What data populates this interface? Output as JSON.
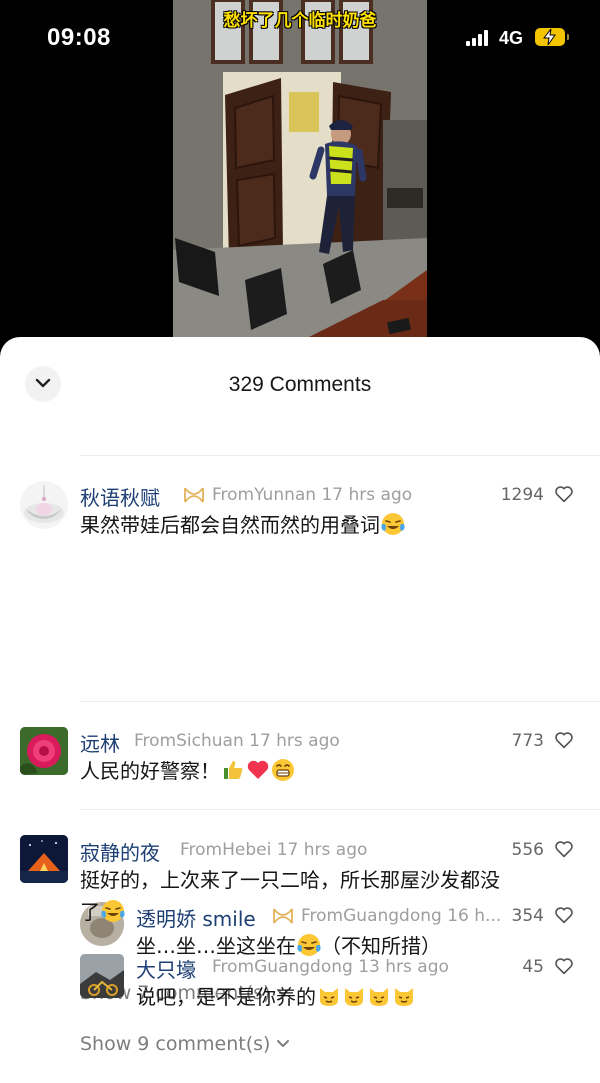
{
  "status_bar": {
    "time": "09:08",
    "network": "4G"
  },
  "video": {
    "caption": "愁坏了几个临时奶爸"
  },
  "sheet": {
    "title": "329 Comments"
  },
  "comments": [
    {
      "user": "秋语秋赋",
      "meta": "FromYunnan 17 hrs ago",
      "likes": "1294",
      "text": "果然带娃后都会自然而然的用叠词",
      "reply": {
        "user": "透明娇 smile",
        "meta": "FromGuangdong 16 h...",
        "likes": "354",
        "text": "坐…坐…坐这坐在",
        "text_after": "（不知所措）"
      },
      "show_more": "Show 7 comment(s)"
    },
    {
      "user": "远林",
      "meta": "FromSichuan 17 hrs ago",
      "likes": "773",
      "text": "人民的好警察！"
    },
    {
      "user": "寂静的夜",
      "meta": "FromHebei 17 hrs ago",
      "likes": "556",
      "text_line1": "挺好的，上次来了一只二哈，所长那屋沙发都没",
      "text_line2": "了",
      "reply": {
        "user": "大只壕",
        "meta": "FromGuangdong 13 hrs ago",
        "likes": "45",
        "text": "说吧，是不是你养的"
      },
      "show_more": "Show 9 comment(s)"
    }
  ],
  "icons": {
    "collapse": "chevron-down-icon",
    "like": "heart-outline-icon",
    "badge": "vip-badge-icon",
    "emoji": [
      "laughing-crying-emoji",
      "thumbs-up-emoji",
      "red-heart-emoji",
      "grinning-emoji",
      "cat-emoji"
    ]
  },
  "colors": {
    "username": "#1d3f74",
    "meta": "#9e9e9e",
    "badge": "#e3b35a",
    "battery": "#f5c400"
  }
}
